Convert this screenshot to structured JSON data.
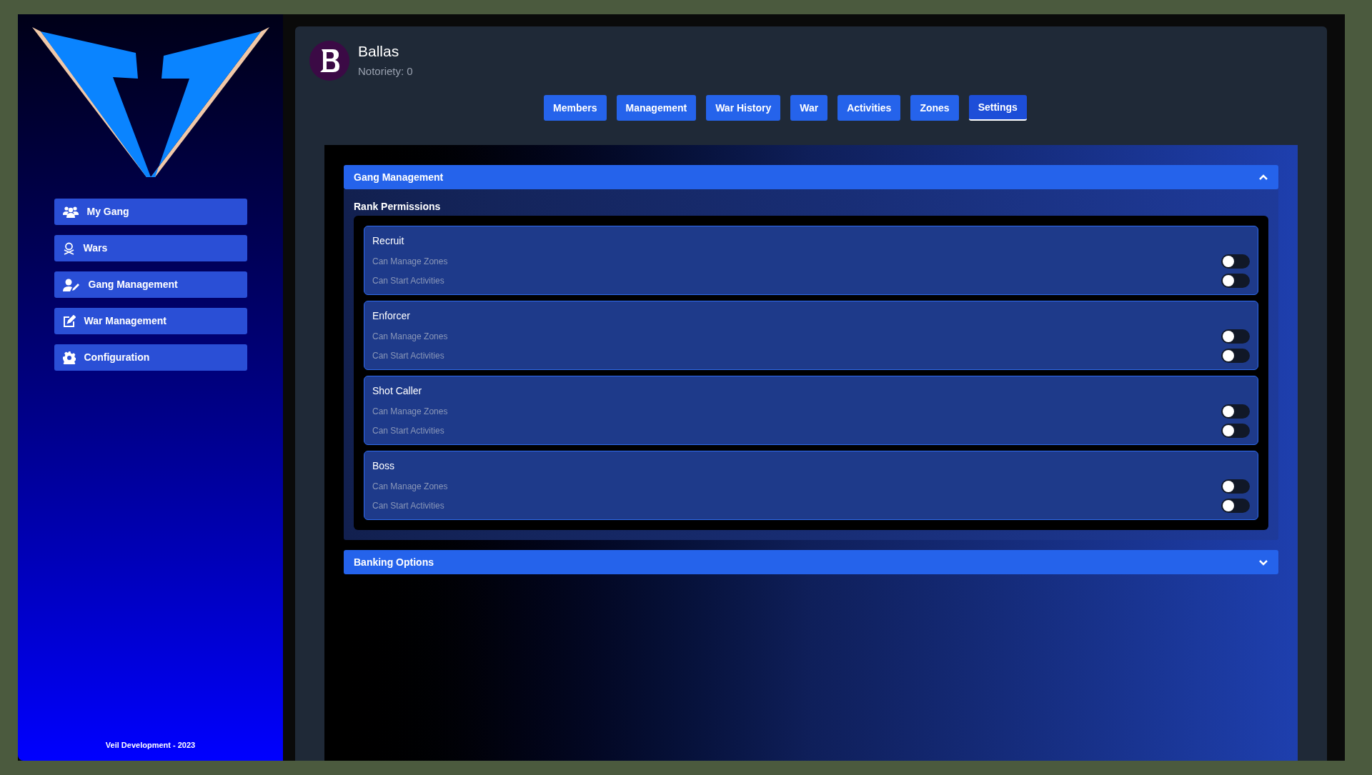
{
  "sidebar": {
    "items": [
      {
        "label": "My Gang"
      },
      {
        "label": "Wars"
      },
      {
        "label": "Gang Management"
      },
      {
        "label": "War Management"
      },
      {
        "label": "Configuration"
      }
    ],
    "footer": "Veil Development - 2023"
  },
  "gang": {
    "name": "Ballas",
    "notoriety": "Notoriety: 0"
  },
  "tabs": [
    {
      "label": "Members",
      "selected": false
    },
    {
      "label": "Management",
      "selected": false
    },
    {
      "label": "War History",
      "selected": false
    },
    {
      "label": "War",
      "selected": false
    },
    {
      "label": "Activities",
      "selected": false
    },
    {
      "label": "Zones",
      "selected": false
    },
    {
      "label": "Settings",
      "selected": true
    }
  ],
  "sections": [
    {
      "title": "Gang Management",
      "expanded": true,
      "subtitle": "Rank Permissions",
      "ranks": [
        {
          "name": "Recruit",
          "permissions": [
            {
              "label": "Can Manage Zones",
              "on": false
            },
            {
              "label": "Can Start Activities",
              "on": false
            }
          ]
        },
        {
          "name": "Enforcer",
          "permissions": [
            {
              "label": "Can Manage Zones",
              "on": false
            },
            {
              "label": "Can Start Activities",
              "on": false
            }
          ]
        },
        {
          "name": "Shot Caller",
          "permissions": [
            {
              "label": "Can Manage Zones",
              "on": false
            },
            {
              "label": "Can Start Activities",
              "on": false
            }
          ]
        },
        {
          "name": "Boss",
          "permissions": [
            {
              "label": "Can Manage Zones",
              "on": false
            },
            {
              "label": "Can Start Activities",
              "on": false
            }
          ]
        }
      ]
    },
    {
      "title": "Banking Options",
      "expanded": false
    }
  ]
}
